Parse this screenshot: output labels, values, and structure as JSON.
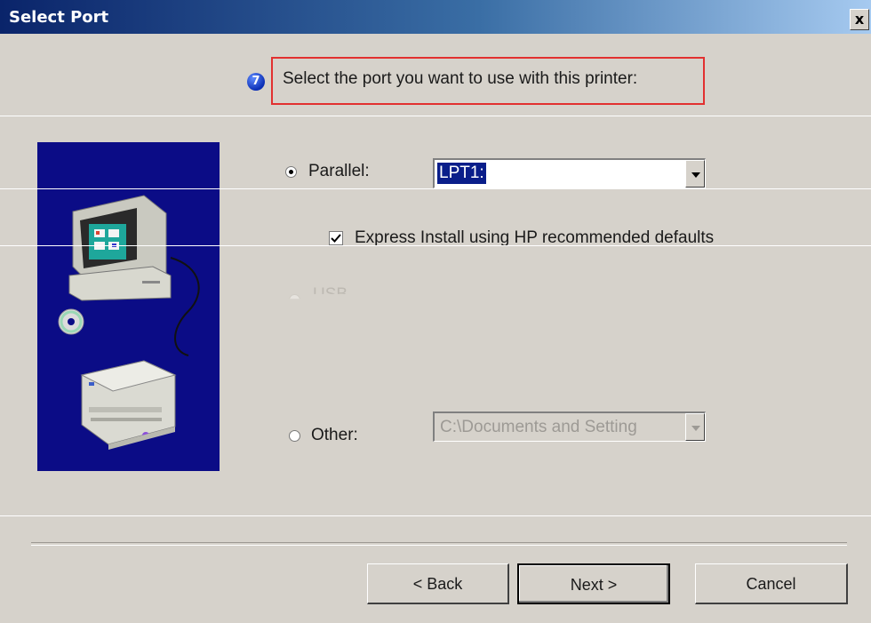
{
  "window": {
    "title": "Select Port",
    "close_label": "x"
  },
  "header": {
    "step_number": "7",
    "instruction": "Select the port you want to use with this printer:"
  },
  "options": {
    "parallel": {
      "label": "Parallel:",
      "selected": true,
      "port_value": "LPT1:"
    },
    "express_install": {
      "label": "Express Install using HP recommended defaults",
      "checked": true
    },
    "usb": {
      "label": "USB",
      "selected": false
    },
    "other": {
      "label": "Other:",
      "selected": false,
      "path_value": "C:\\Documents and Setting"
    }
  },
  "buttons": {
    "back": "< Back",
    "next": "Next >",
    "cancel": "Cancel"
  },
  "colors": {
    "dialog_bg": "#d6d2cb",
    "title_bar": "#0a246a",
    "illustration_bg": "#0b0c86",
    "highlight_box": "#e23030",
    "selection": "#0a1e8a"
  }
}
